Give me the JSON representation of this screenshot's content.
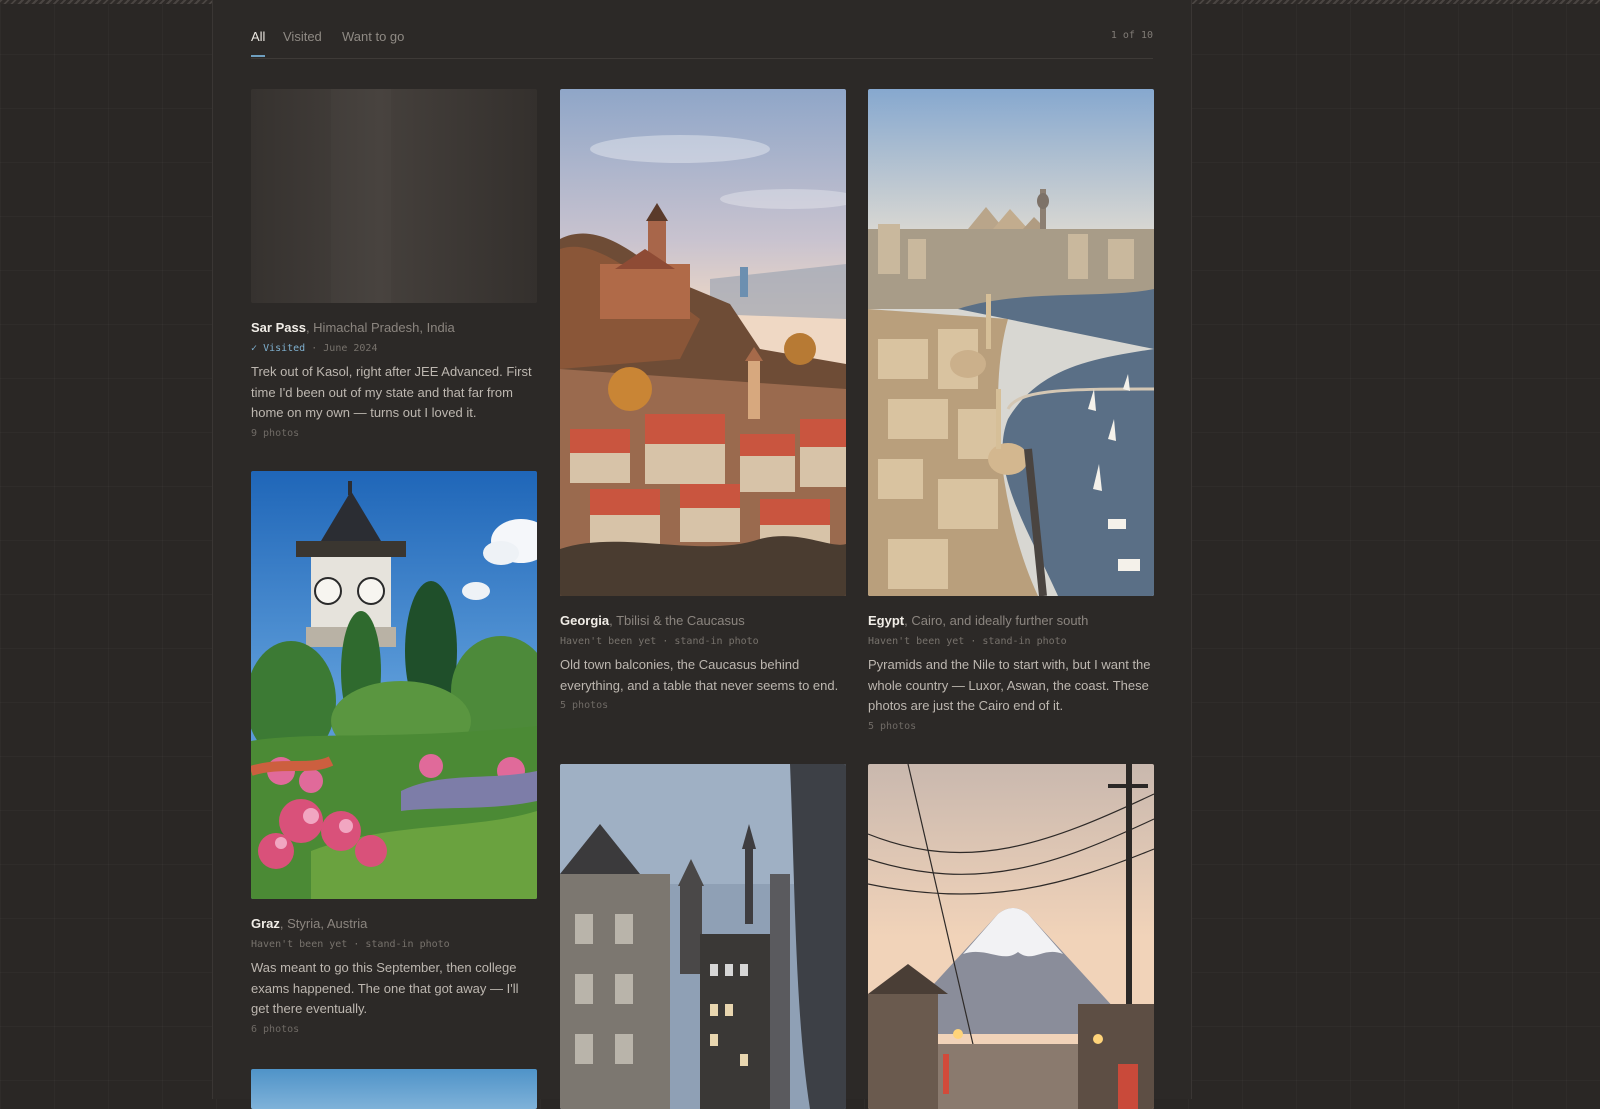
{
  "tabs": [
    {
      "label": "All",
      "active": true
    },
    {
      "label": "Visited",
      "active": false
    },
    {
      "label": "Want to go",
      "active": false
    }
  ],
  "pager": {
    "text": "1 of 10"
  },
  "cards": [
    {
      "name": "Sar Pass",
      "region": ", Himachal Pradesh, India",
      "status": "Visited",
      "status_detail": " · June 2024",
      "description": "Trek out of Kasol, right after JEE Advanced. First time I'd been out of my state and that far from home on my own — turns out I loved it.",
      "photos": "9 photos"
    },
    {
      "name": "Georgia",
      "region": ", Tbilisi & the Caucasus",
      "status": "Haven't been yet · stand-in photo",
      "description": "Old town balconies, the Caucasus behind everything, and a table that never seems to end.",
      "photos": "5 photos"
    },
    {
      "name": "Egypt",
      "region": ", Cairo, and ideally further south",
      "status": "Haven't been yet · stand-in photo",
      "description": "Pyramids and the Nile to start with, but I want the whole country — Luxor, Aswan, the coast. These photos are just the Cairo end of it.",
      "photos": "5 photos"
    },
    {
      "name": "Graz",
      "region": ", Styria, Austria",
      "status": "Haven't been yet · stand-in photo",
      "description": "Was meant to go this September, then college exams happened. The one that got away — I'll get there eventually.",
      "photos": "6 photos"
    }
  ],
  "icons": {
    "visited_check": "check-icon"
  },
  "colors": {
    "accent": "#6f9fbf",
    "visited": "#7fb0cf",
    "background": "#2a2725"
  }
}
